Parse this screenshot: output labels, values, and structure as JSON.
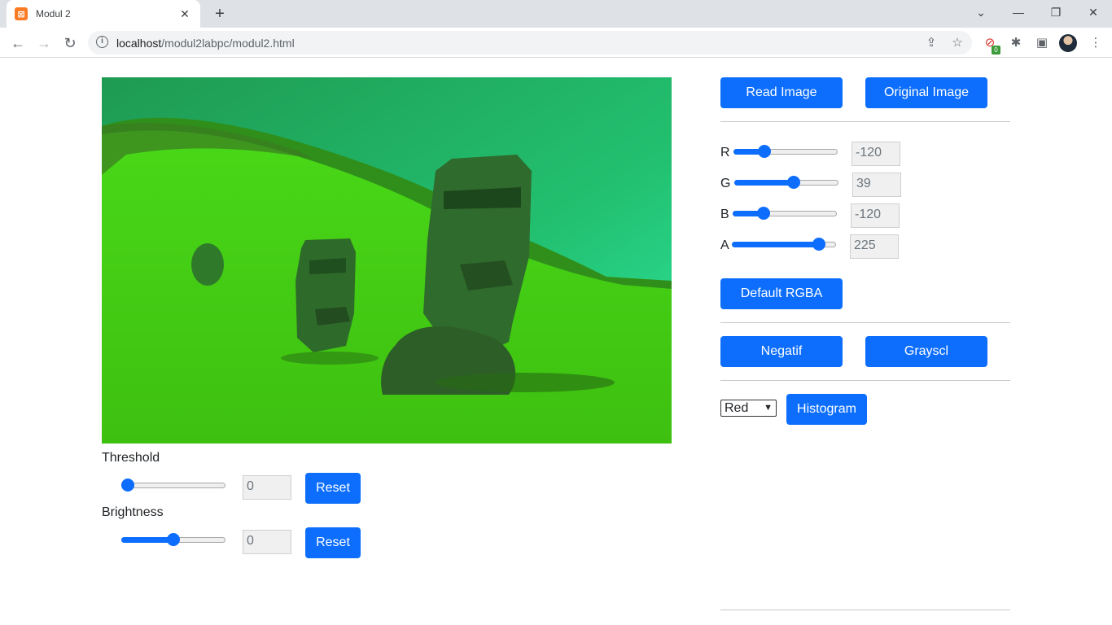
{
  "browser": {
    "tab_title": "Modul 2",
    "tab_favicon": "xampp-icon",
    "url_host": "localhost",
    "url_path": "/modul2labpc/modul2.html",
    "ext_badge": "0"
  },
  "controls": {
    "read_image": "Read Image",
    "original_image": "Original Image",
    "default_rgba": "Default RGBA",
    "negatif": "Negatif",
    "grayscl": "Grayscl",
    "histogram": "Histogram",
    "histogram_channel": "Red",
    "rgba": [
      {
        "label": "R",
        "value": "-120",
        "level": 0.27
      },
      {
        "label": "G",
        "value": "39",
        "level": 0.58
      },
      {
        "label": "B",
        "value": "-120",
        "level": 0.27
      },
      {
        "label": "A",
        "value": "225",
        "level": 0.88
      }
    ]
  },
  "threshold": {
    "label": "Threshold",
    "value": "0",
    "level": 0.0,
    "reset": "Reset"
  },
  "brightness": {
    "label": "Brightness",
    "value": "0",
    "level": 0.5,
    "reset": "Reset"
  }
}
